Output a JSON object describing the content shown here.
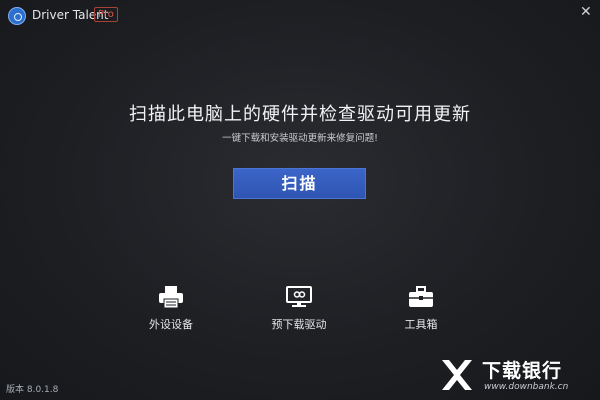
{
  "titlebar": {
    "app_name": "Driver Talent",
    "badge": "Pro",
    "close_glyph": "✕"
  },
  "main": {
    "headline": "扫描此电脑上的硬件并检查驱动可用更新",
    "subline": "一键下载和安装驱动更新来修复问题!",
    "scan_button": "扫描"
  },
  "features": [
    {
      "label": "外设设备",
      "icon": "printer-icon"
    },
    {
      "label": "预下载驱动",
      "icon": "download-monitor-icon"
    },
    {
      "label": "工具箱",
      "icon": "toolbox-icon"
    }
  ],
  "footer": {
    "version": "版本 8.0.1.8"
  },
  "watermark": {
    "name": "下载银行",
    "url": "www.downbank.cn"
  },
  "colors": {
    "accent": "#3a62c4",
    "background": "#1e2024",
    "pro_badge": "#e05a4a"
  }
}
